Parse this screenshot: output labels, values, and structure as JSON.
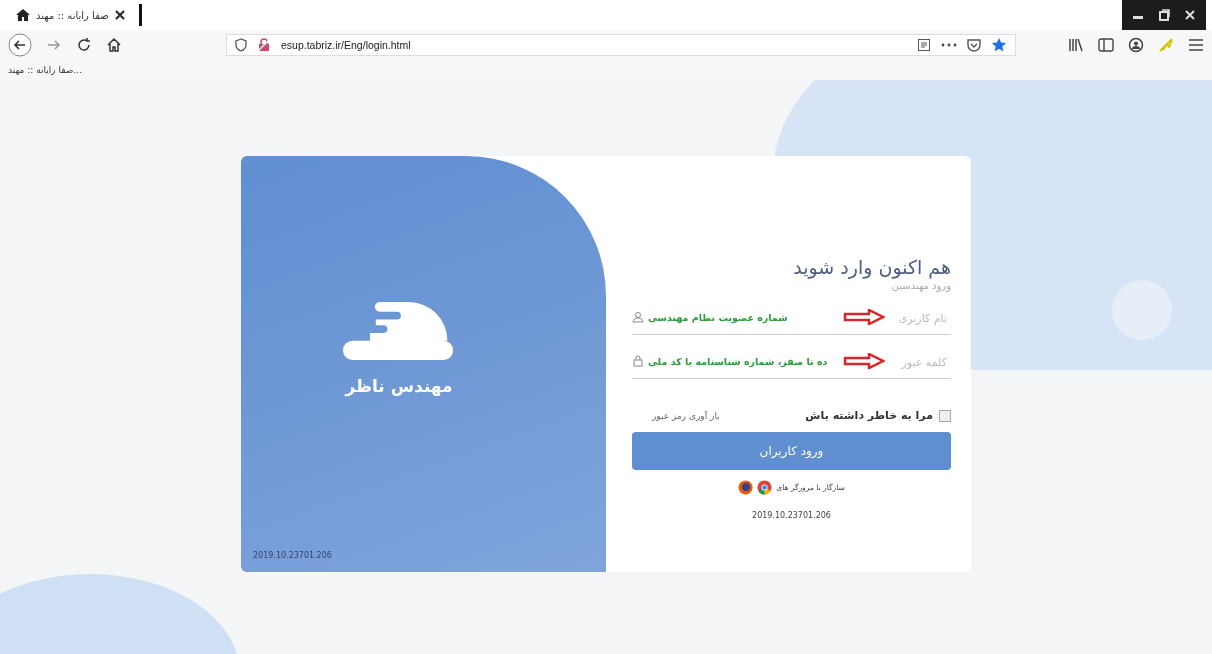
{
  "browser": {
    "tab": {
      "title": "صفا رایانه :: مهند"
    },
    "url": "esup.tabriz.ir/Eng/login.html",
    "bookmarks": [
      "صفا رایانه :: مهند..."
    ]
  },
  "brand": {
    "name": "مهندس ناظر",
    "version": "2019.10.23701.206"
  },
  "login": {
    "title": "هم اکنون وارد شوید",
    "subtitle": "ورود مهندسین",
    "fields": [
      {
        "kind": "user",
        "placeholder": "نام کاربری",
        "annotation": "شماره عضویت نظام مهندسی"
      },
      {
        "kind": "password",
        "placeholder": "کلمه عبور",
        "annotation": "ده تا صفر، شماره شناسنامه یا کد ملی"
      }
    ],
    "remember": {
      "label": "مرا به خاطر داشته باش",
      "checked": false
    },
    "forgot_link": "باز آوری رمز عبور",
    "submit": "ورود کاربران",
    "compat": "سازگار با مرورگر های",
    "version": "2019.10.23701.206"
  }
}
